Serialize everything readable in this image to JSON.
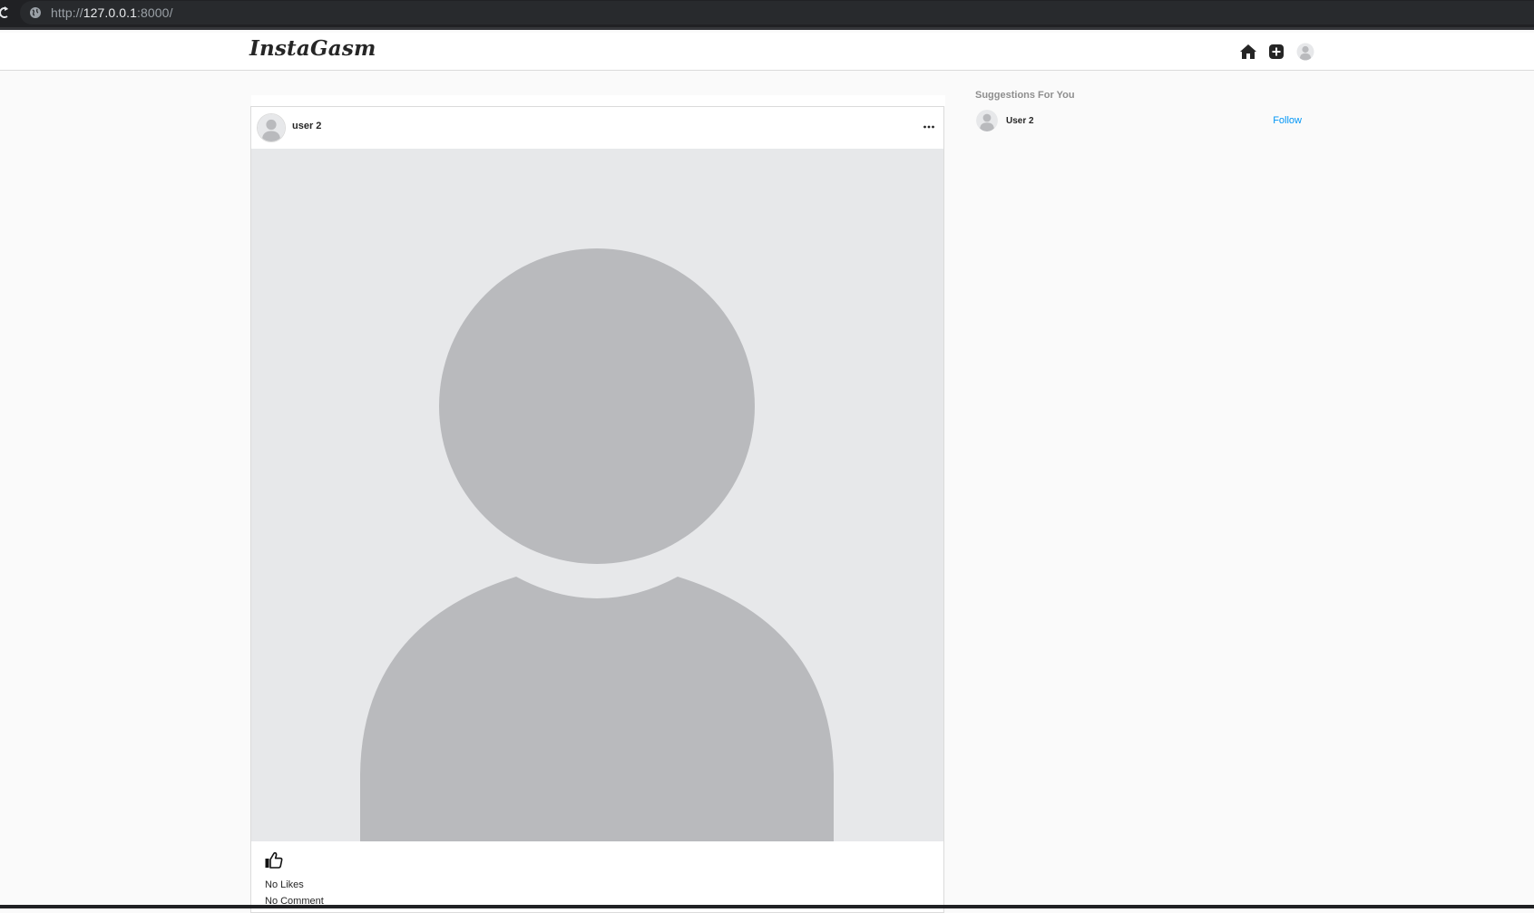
{
  "browser": {
    "url_scheme": "http://",
    "url_host": "127.0.0.1",
    "url_rest": ":8000/"
  },
  "app": {
    "logo": "InstaGasm"
  },
  "nav": {
    "icons": [
      "home-icon",
      "add-post-icon",
      "profile-avatar-icon"
    ]
  },
  "post": {
    "username": "user 2",
    "more_icon": "ellipsis-icon",
    "like_icon": "thumbs-up-icon",
    "likes_text": "No Likes",
    "comments_text": "No Comment"
  },
  "suggestions": {
    "title": "Suggestions For You",
    "items": [
      {
        "name": "User 2",
        "action": "Follow"
      }
    ]
  },
  "colors": {
    "accent": "#0095f6",
    "background": "#fafafa",
    "placeholder_bg": "#e7e8ea",
    "placeholder_figure": "#b9babd"
  }
}
